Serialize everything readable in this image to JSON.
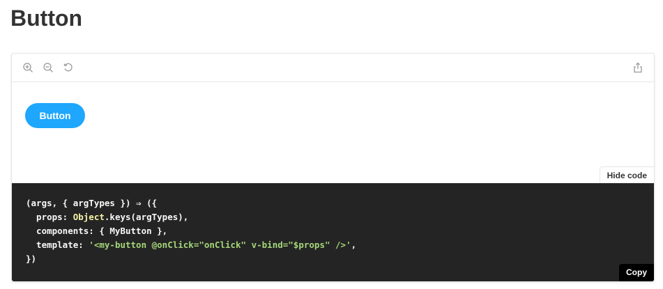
{
  "page": {
    "title": "Button"
  },
  "toolbar": {
    "zoom_in_icon": "zoom-in-icon",
    "zoom_out_icon": "zoom-out-icon",
    "reset_zoom_icon": "reset-zoom-icon",
    "share_icon": "share-icon"
  },
  "preview": {
    "button_label": "Button",
    "button_color": "#1ea7fd"
  },
  "controls": {
    "hide_code_label": "Hide code",
    "copy_label": "Copy"
  },
  "code": {
    "line1": "(args, { argTypes }) ⇒ ({",
    "line2_key": "  props: ",
    "line2_obj": "Object",
    "line2_rest": ".keys(argTypes),",
    "line3": "  components: { MyButton },",
    "line4_key": "  template: ",
    "line4_str": "'<my-button @onClick=\"onClick\" v-bind=\"$props\" />'",
    "line4_end": ",",
    "line5": "})"
  },
  "colors": {
    "code_bg": "#242424",
    "string": "#a5d67a",
    "object": "#f6f1a6"
  }
}
